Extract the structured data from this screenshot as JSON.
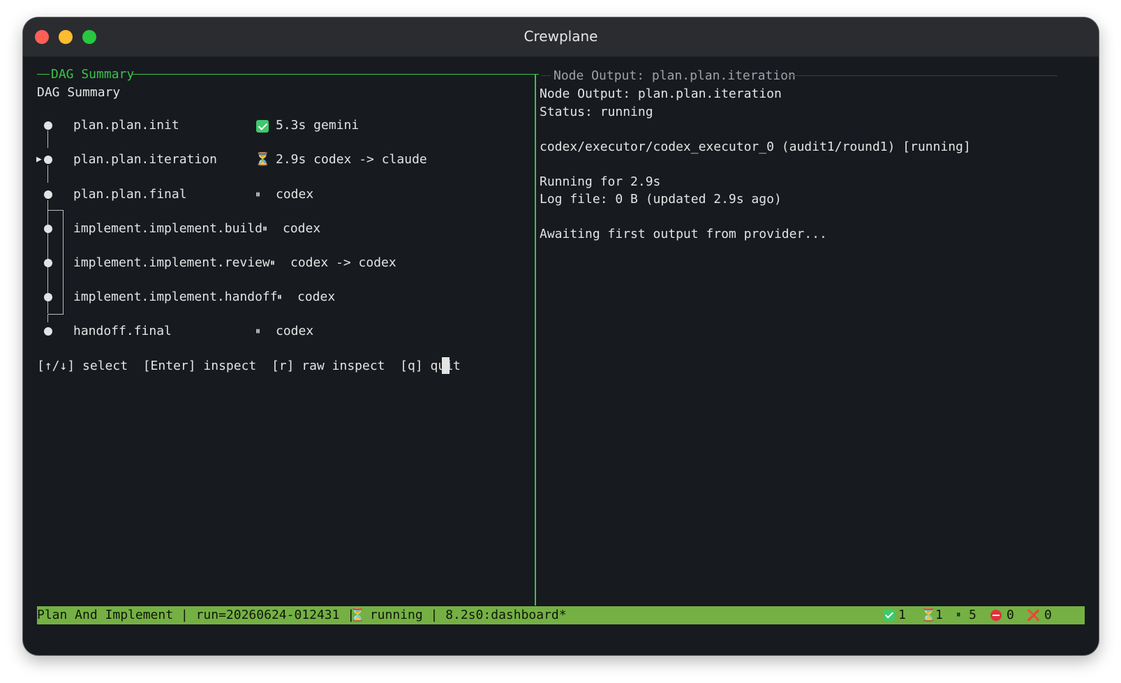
{
  "window": {
    "title": "Crewplane"
  },
  "dag_panel": {
    "frame_label": "DAG Summary",
    "heading": "DAG Summary",
    "selected_marker": "▶",
    "nodes": [
      {
        "name": "plan.plan.init",
        "status_icon": "check-icon",
        "status": "5.3s gemini"
      },
      {
        "name": "plan.plan.iteration",
        "status_icon": "hourglass-icon",
        "status": "2.9s codex -> claude"
      },
      {
        "name": "plan.plan.final",
        "status_icon": "pause-icon",
        "pause_glyph": "⏸",
        "status": "codex"
      },
      {
        "name": "implement.implement.build",
        "status_icon": "pause-icon",
        "pause_glyph": "⏸",
        "status": "codex"
      },
      {
        "name": "implement.implement.review",
        "status_icon": "pause-icon",
        "pause_glyph": "⏸",
        "status": "codex -> codex"
      },
      {
        "name": "implement.implement.handoff",
        "status_icon": "pause-icon",
        "pause_glyph": "⏸",
        "status": "codex"
      },
      {
        "name": "handoff.final",
        "status_icon": "pause-icon",
        "pause_glyph": "⏸",
        "status": "codex"
      }
    ],
    "hourglass_glyph": "⏳",
    "keybinds": "[↑/↓] select  [Enter] inspect  [r] raw inspect  [q] quit"
  },
  "output_panel": {
    "frame_label": "Node Output: plan.plan.iteration",
    "heading": "Node Output: plan.plan.iteration",
    "status_line": "Status: running",
    "executor_line": "codex/executor/codex_executor_0 (audit1/round1) [running]",
    "running_line": "Running for 2.9s",
    "log_line": "Log file: 0 B (updated 2.9s ago)",
    "awaiting_line": "Awaiting first output from provider..."
  },
  "status_bar": {
    "left_text": "Plan And Implement | run=20260624-012431 | ",
    "hourglass_glyph": "⏳",
    "state_text": " running | 8.2s0:dashboard*",
    "counts": {
      "done": "1",
      "running": "1",
      "pause_glyph": "⏸",
      "paused": "5",
      "blocked": "0",
      "failed_glyph": "❌",
      "failed": "0"
    }
  },
  "colors": {
    "frame_green": "#3cc24a",
    "status_bar_bg": "#74b043",
    "terminal_bg": "#171a1f"
  }
}
